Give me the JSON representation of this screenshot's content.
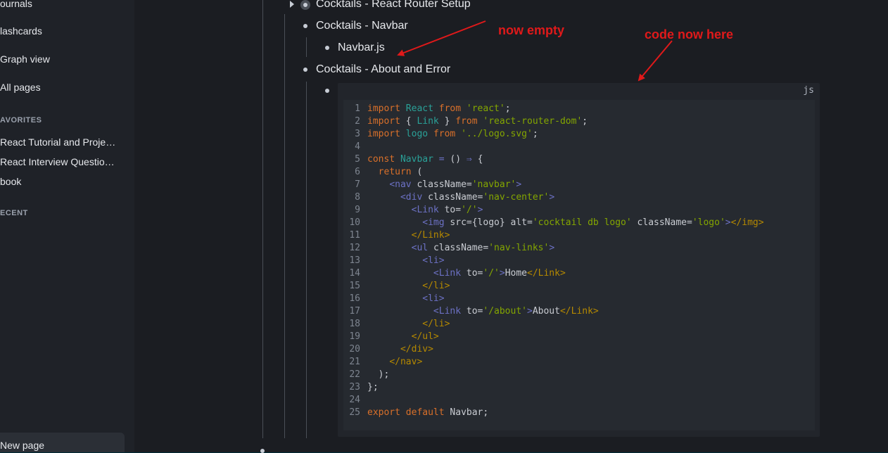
{
  "sidebar": {
    "nav": [
      "ournals",
      "lashcards",
      "Graph view",
      "All pages"
    ],
    "favorites_title": "AVORITES",
    "favorites": [
      "React Tutorial and Projects…",
      "React Interview Questions …",
      "book"
    ],
    "recent_title": "ECENT",
    "new_page_label": "New page"
  },
  "blocks": {
    "router_setup": "Cocktails - React Router Setup",
    "navbar": "Cocktails - Navbar",
    "navbar_js": "Navbar.js",
    "about_error": "Cocktails - About and Error"
  },
  "code_block": {
    "language": "js",
    "lines": [
      [
        [
          "kw",
          "import "
        ],
        [
          "id",
          "React "
        ],
        [
          "kw",
          "from "
        ],
        [
          "st",
          "'react'"
        ],
        [
          "pl",
          ";"
        ]
      ],
      [
        [
          "kw",
          "import "
        ],
        [
          "pl",
          "{ "
        ],
        [
          "id",
          "Link "
        ],
        [
          "pl",
          "} "
        ],
        [
          "kw",
          "from "
        ],
        [
          "st",
          "'react-router-dom'"
        ],
        [
          "pl",
          ";"
        ]
      ],
      [
        [
          "kw",
          "import "
        ],
        [
          "id",
          "logo "
        ],
        [
          "kw",
          "from "
        ],
        [
          "st",
          "'../logo.svg'"
        ],
        [
          "pl",
          ";"
        ]
      ],
      [],
      [
        [
          "kw",
          "const "
        ],
        [
          "id",
          "Navbar "
        ],
        [
          "op",
          "= "
        ],
        [
          "pl",
          "() "
        ],
        [
          "op",
          "⇒ "
        ],
        [
          "pl",
          "{"
        ]
      ],
      [
        [
          "pl",
          "  "
        ],
        [
          "kw",
          "return "
        ],
        [
          "pl",
          "("
        ]
      ],
      [
        [
          "pl",
          "    "
        ],
        [
          "op",
          "<nav "
        ],
        [
          "pl",
          "className="
        ],
        [
          "st",
          "'navbar'"
        ],
        [
          "op",
          ">"
        ]
      ],
      [
        [
          "pl",
          "      "
        ],
        [
          "op",
          "<div "
        ],
        [
          "pl",
          "className="
        ],
        [
          "st",
          "'nav-center'"
        ],
        [
          "op",
          ">"
        ]
      ],
      [
        [
          "pl",
          "        "
        ],
        [
          "op",
          "<Link "
        ],
        [
          "pl",
          "to="
        ],
        [
          "st",
          "'/'"
        ],
        [
          "op",
          ">"
        ]
      ],
      [
        [
          "pl",
          "          "
        ],
        [
          "op",
          "<img "
        ],
        [
          "pl",
          "src={logo} alt="
        ],
        [
          "st",
          "'cocktail db logo' "
        ],
        [
          "pl",
          "className="
        ],
        [
          "st",
          "'logo'"
        ],
        [
          "op",
          ">"
        ],
        [
          "tg",
          "</img>"
        ]
      ],
      [
        [
          "pl",
          "        "
        ],
        [
          "tg",
          "</Link>"
        ]
      ],
      [
        [
          "pl",
          "        "
        ],
        [
          "op",
          "<ul "
        ],
        [
          "pl",
          "className="
        ],
        [
          "st",
          "'nav-links'"
        ],
        [
          "op",
          ">"
        ]
      ],
      [
        [
          "pl",
          "          "
        ],
        [
          "op",
          "<li>"
        ]
      ],
      [
        [
          "pl",
          "            "
        ],
        [
          "op",
          "<Link "
        ],
        [
          "pl",
          "to="
        ],
        [
          "st",
          "'/'"
        ],
        [
          "op",
          ">"
        ],
        [
          "pl",
          "Home"
        ],
        [
          "tg",
          "</Link>"
        ]
      ],
      [
        [
          "pl",
          "          "
        ],
        [
          "tg",
          "</li>"
        ]
      ],
      [
        [
          "pl",
          "          "
        ],
        [
          "op",
          "<li>"
        ]
      ],
      [
        [
          "pl",
          "            "
        ],
        [
          "op",
          "<Link "
        ],
        [
          "pl",
          "to="
        ],
        [
          "st",
          "'/about'"
        ],
        [
          "op",
          ">"
        ],
        [
          "pl",
          "About"
        ],
        [
          "tg",
          "</Link>"
        ]
      ],
      [
        [
          "pl",
          "          "
        ],
        [
          "tg",
          "</li>"
        ]
      ],
      [
        [
          "pl",
          "        "
        ],
        [
          "tg",
          "</ul>"
        ]
      ],
      [
        [
          "pl",
          "      "
        ],
        [
          "tg",
          "</div>"
        ]
      ],
      [
        [
          "pl",
          "    "
        ],
        [
          "tg",
          "</nav>"
        ]
      ],
      [
        [
          "pl",
          "  );"
        ]
      ],
      [
        [
          "pl",
          "};"
        ]
      ],
      [],
      [
        [
          "kw",
          "export "
        ],
        [
          "kw",
          "default "
        ],
        [
          "pl",
          "Navbar;"
        ]
      ]
    ]
  },
  "annotations": {
    "now_empty": "now empty",
    "code_now_here": "code now here",
    "color": "#e0191a"
  }
}
